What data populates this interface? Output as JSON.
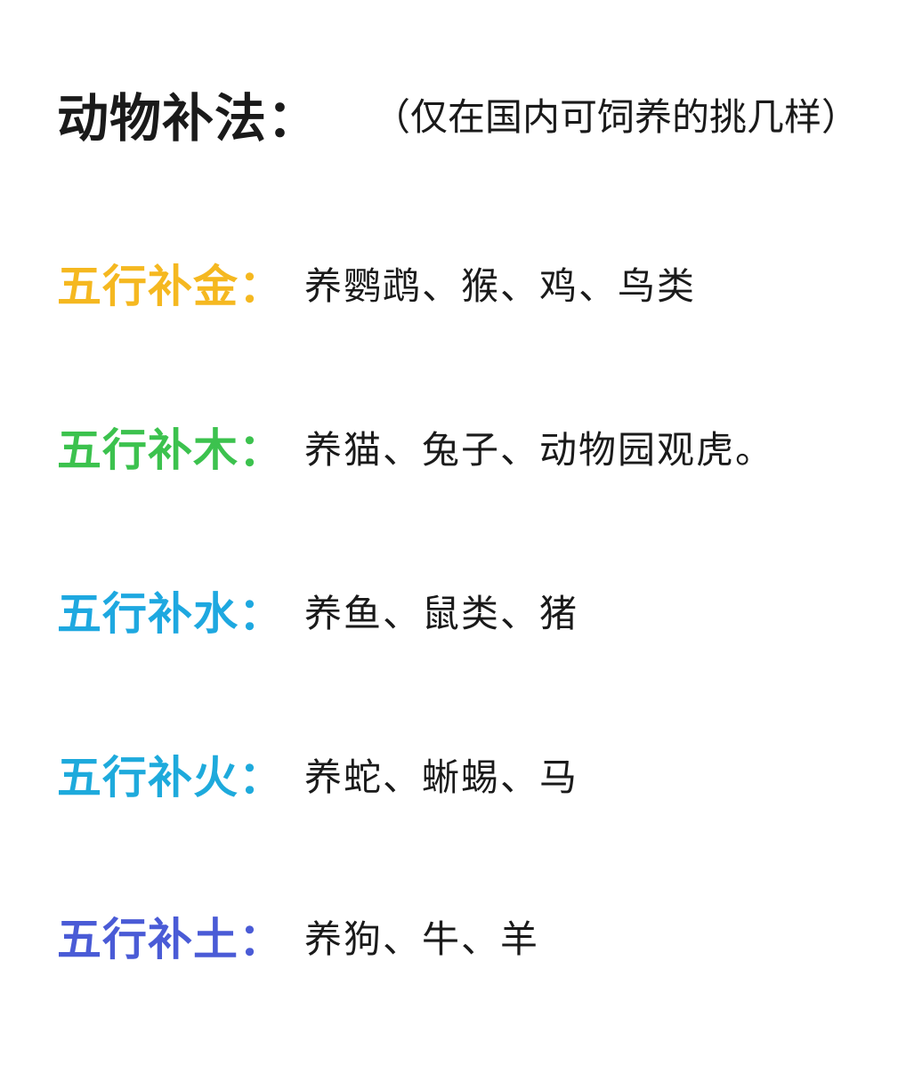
{
  "title": {
    "main": "动物补法：",
    "note": "（仅在国内可饲养的挑几样）"
  },
  "items": [
    {
      "label": "五行补金：",
      "value": "养鹦鹉、猴、鸡、鸟类",
      "color": "#f5b820"
    },
    {
      "label": "五行补木：",
      "value": "养猫、兔子、动物园观虎。",
      "color": "#3cc24e"
    },
    {
      "label": "五行补水：",
      "value": "养鱼、鼠类、猪",
      "color": "#1ea8e0"
    },
    {
      "label": "五行补火：",
      "value": "养蛇、蜥蜴、马",
      "color": "#1eaadc"
    },
    {
      "label": "五行补土：",
      "value": "养狗、牛、羊",
      "color": "#4a5bd6"
    }
  ]
}
